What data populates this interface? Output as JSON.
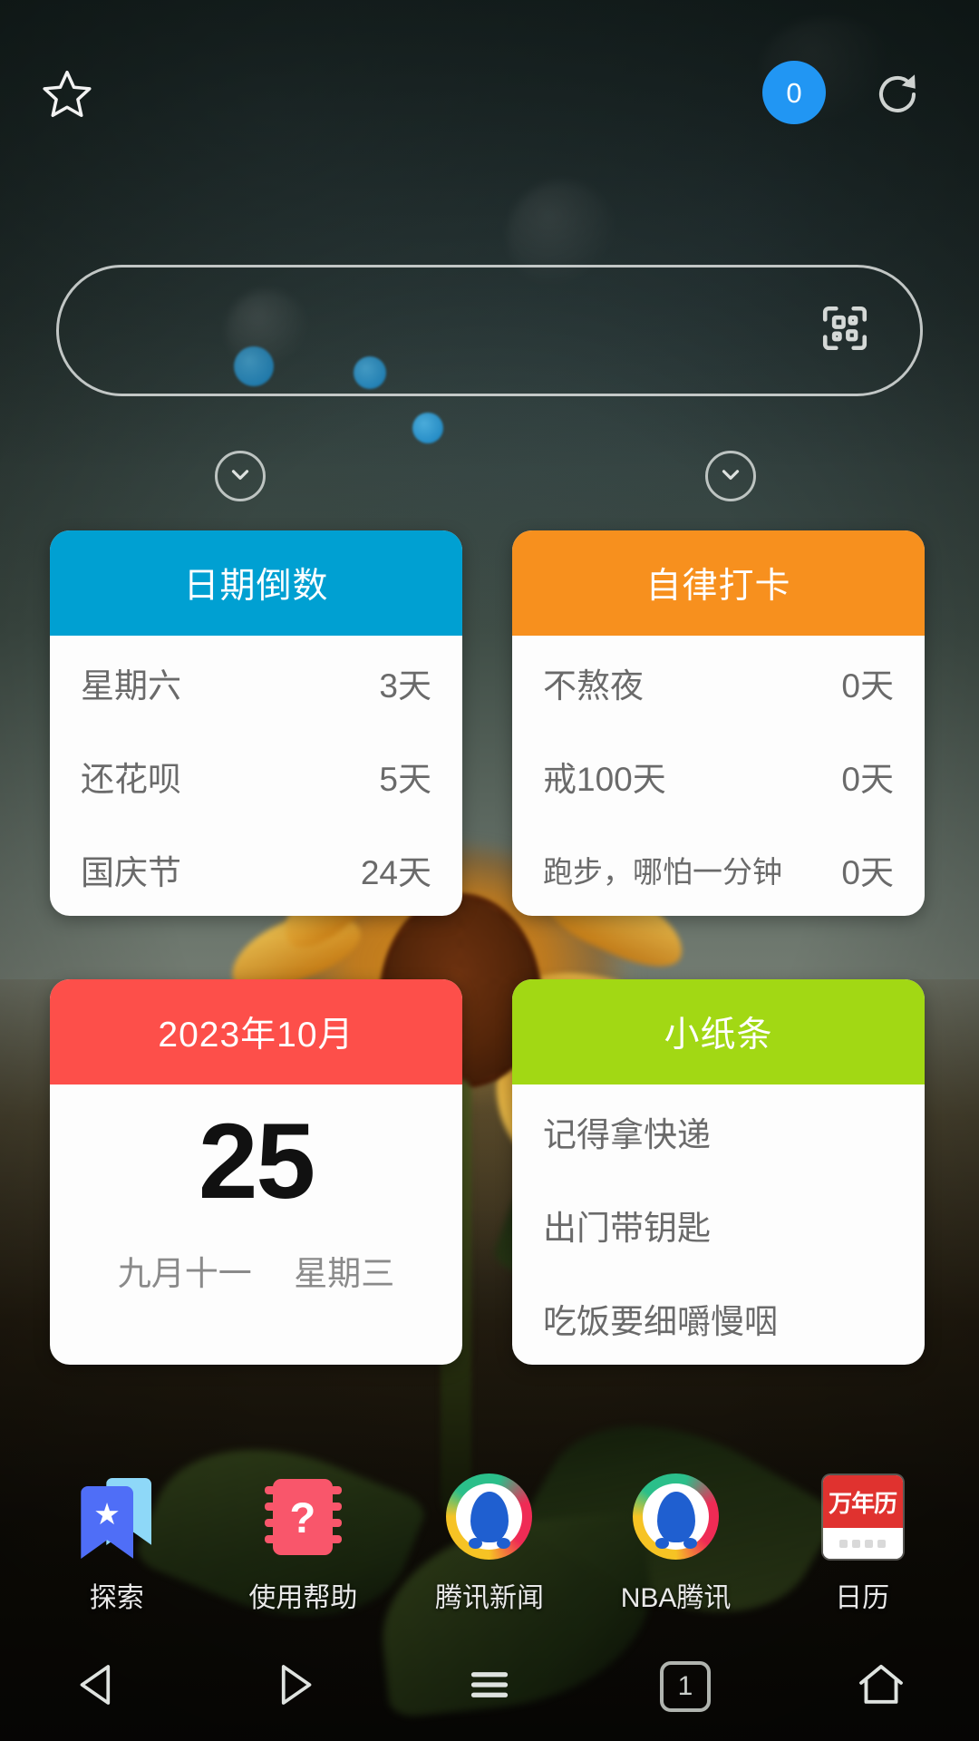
{
  "topbar": {
    "star_icon": "star-outline-icon",
    "badge_count": "0",
    "refresh_icon": "refresh-icon"
  },
  "search": {
    "placeholder": "",
    "value": "",
    "qr_icon": "qr-scan-icon"
  },
  "expanders": {
    "left_icon": "chevron-down-icon",
    "right_icon": "chevron-down-icon"
  },
  "widgets": {
    "countdown": {
      "title": "日期倒数",
      "header_color": "#00a0d2",
      "rows": [
        {
          "label": "星期六",
          "value": "3天"
        },
        {
          "label": "还花呗",
          "value": "5天"
        },
        {
          "label": "国庆节",
          "value": "24天"
        }
      ]
    },
    "checkin": {
      "title": "自律打卡",
      "header_color": "#f7901e",
      "rows": [
        {
          "label": "不熬夜",
          "value": "0天"
        },
        {
          "label": "戒100天",
          "value": "0天"
        },
        {
          "label": "跑步，哪怕一分钟",
          "value": "0天"
        }
      ]
    },
    "calendar": {
      "title": "2023年10月",
      "header_color": "#fd4f4a",
      "day": "25",
      "lunar": "九月十一",
      "weekday": "星期三"
    },
    "notes": {
      "title": "小纸条",
      "header_color": "#a2d814",
      "items": [
        "记得拿快递",
        "出门带钥匙",
        "吃饭要细嚼慢咽"
      ]
    }
  },
  "dock": [
    {
      "label": "探索",
      "icon": "explore-bookmark-icon"
    },
    {
      "label": "使用帮助",
      "icon": "help-notebook-icon"
    },
    {
      "label": "腾讯新闻",
      "icon": "qq-penguin-icon"
    },
    {
      "label": "NBA腾讯",
      "icon": "qq-penguin-icon"
    },
    {
      "label": "日历",
      "icon": "calendar-icon",
      "icon_text": "万年历"
    }
  ],
  "navbar": {
    "back_icon": "back-triangle-icon",
    "forward_icon": "forward-triangle-icon",
    "menu_icon": "menu-lines-icon",
    "tab_count": "1",
    "home_icon": "home-icon"
  }
}
